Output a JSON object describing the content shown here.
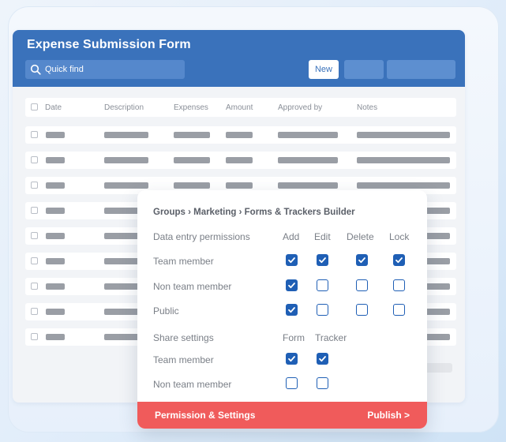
{
  "form": {
    "title": "Expense Submission Form",
    "search_placeholder": "Quick find",
    "new_button": "New",
    "columns": [
      "Date",
      "Description",
      "Expenses",
      "Amount",
      "Approved by",
      "Notes"
    ]
  },
  "popup": {
    "breadcrumb": "Groups › Marketing › Forms & Trackers Builder",
    "data_entry_label": "Data entry permissions",
    "data_entry_columns": [
      "Add",
      "Edit",
      "Delete",
      "Lock"
    ],
    "data_entry_rows": [
      {
        "label": "Team member",
        "checks": [
          true,
          true,
          true,
          true
        ]
      },
      {
        "label": "Non team member",
        "checks": [
          true,
          false,
          false,
          false
        ]
      },
      {
        "label": "Public",
        "checks": [
          true,
          false,
          false,
          false
        ]
      }
    ],
    "share_label": "Share settings",
    "share_columns": [
      "Form",
      "Tracker"
    ],
    "share_rows": [
      {
        "label": "Team member",
        "checks": [
          true,
          true
        ]
      },
      {
        "label": "Non team member",
        "checks": [
          false,
          false
        ]
      }
    ],
    "footer_left": "Permission & Settings",
    "footer_right": "Publish >"
  },
  "colors": {
    "header_blue": "#3a72bb",
    "check_blue": "#1f5fb5",
    "footer_red": "#f05b5b"
  }
}
